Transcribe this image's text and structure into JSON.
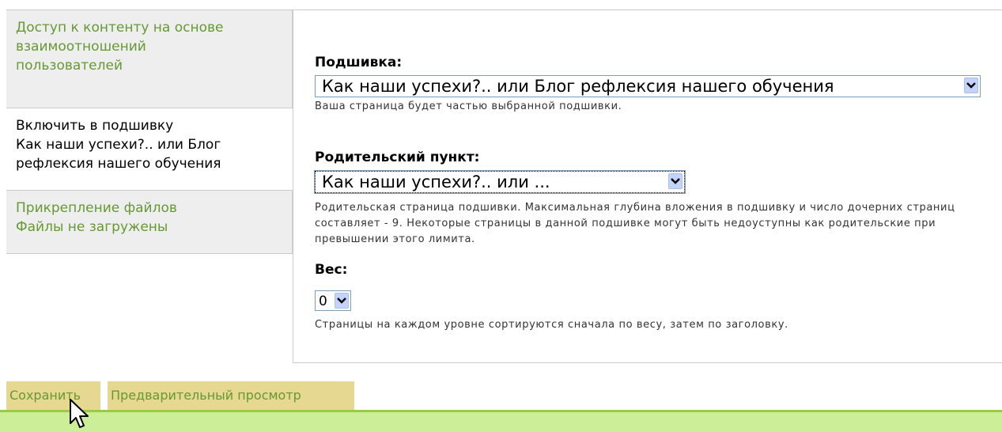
{
  "tabs": [
    {
      "lines": [
        "Доступ к контенту на основе",
        "взаимоотношений",
        "пользователей"
      ],
      "active": false
    },
    {
      "lines": [
        "Включить в подшивку",
        "Как наши успехи?.. или Блог",
        "рефлексия нашего обучения"
      ],
      "active": true
    },
    {
      "lines": [
        "Прикрепление файлов",
        "Файлы не загружены"
      ],
      "active": false
    }
  ],
  "book": {
    "label": "Подшивка:",
    "selected": "Как наши успехи?.. или Блог рефлексия нашего обучения",
    "description": "Ваша страница будет частью выбранной подшивки."
  },
  "parent": {
    "label": "Родительский пункт:",
    "selected": "Как наши успехи?.. или ...",
    "description": "Родительская страница подшивки. Максимальная глубина вложения в подшивку и число дочерних страниц составляет - 9. Некоторые страницы в данной подшивке могут быть недоуступны как родительские при превышении этого лимита."
  },
  "weight": {
    "label": "Вес:",
    "selected": "0",
    "description": "Страницы на каждом уровне сортируются сначала по весу, затем по заголовку."
  },
  "buttons": {
    "save_label": "Сохранить",
    "preview_label": "Предварительный просмотр"
  },
  "icons": {
    "dropdown": "chevron-down-icon",
    "cursor": "mouse-pointer-icon"
  },
  "colors": {
    "link_green": "#669933",
    "button_bg": "#e6d890",
    "footer_bar": "#ccee99",
    "inactive_tab_bg": "#eeeeee"
  }
}
